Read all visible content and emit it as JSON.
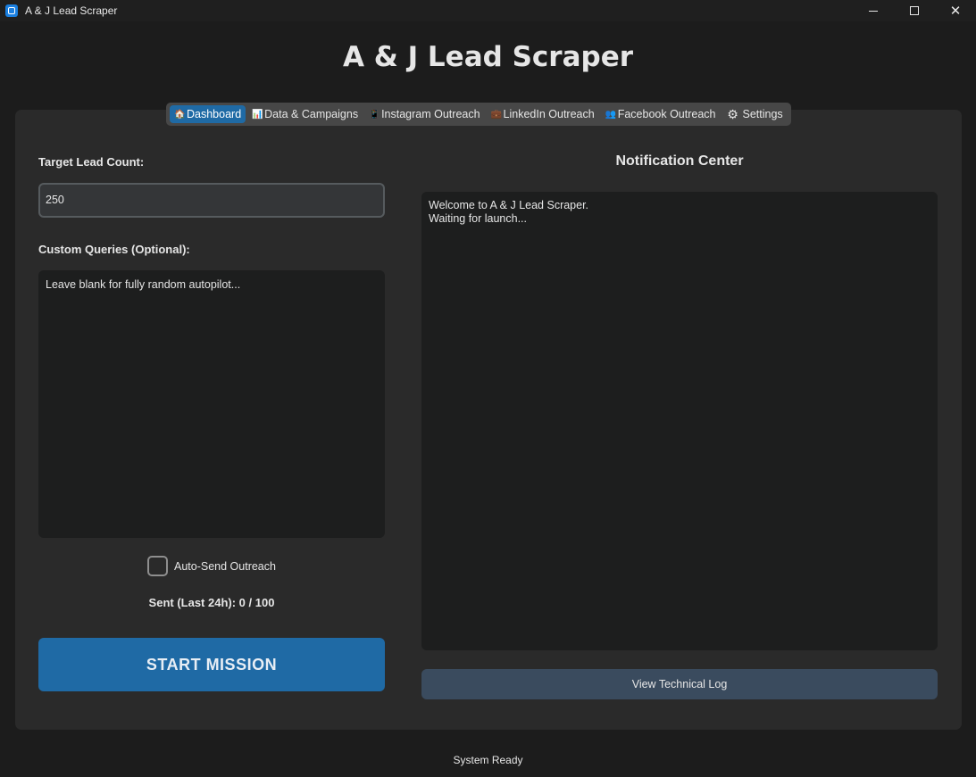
{
  "window": {
    "title": "A & J Lead Scraper",
    "controls": {
      "minimize": "",
      "maximize": "",
      "close": "✕"
    }
  },
  "header": {
    "title": "A & J Lead Scraper"
  },
  "tabs": [
    {
      "label": "Dashboard",
      "icon": "home-icon",
      "glyph": "🏠",
      "active": true
    },
    {
      "label": "Data & Campaigns",
      "icon": "chart-icon",
      "glyph": "📊",
      "active": false
    },
    {
      "label": "Instagram Outreach",
      "icon": "phone-icon",
      "glyph": "📱",
      "active": false
    },
    {
      "label": "LinkedIn Outreach",
      "icon": "briefcase-icon",
      "glyph": "💼",
      "active": false
    },
    {
      "label": "Facebook Outreach",
      "icon": "people-icon",
      "glyph": "👥",
      "active": false
    },
    {
      "label": "Settings",
      "icon": "gear-icon",
      "glyph": "⚙",
      "active": false
    }
  ],
  "form": {
    "target_label": "Target Lead Count:",
    "target_value": "250",
    "queries_label": "Custom Queries (Optional):",
    "queries_placeholder": "Leave blank for fully random autopilot...",
    "auto_send_label": "Auto-Send Outreach",
    "auto_send_checked": false,
    "sent_text": "Sent (Last 24h): 0 / 100",
    "start_button": "START MISSION"
  },
  "notifications": {
    "title": "Notification Center",
    "lines": [
      "Welcome to A & J Lead Scraper.",
      "Waiting for launch..."
    ],
    "log_button": "View Technical Log"
  },
  "status": {
    "text": "System Ready"
  },
  "colors": {
    "accent": "#1f6aa5",
    "background": "#1c1c1c",
    "panel": "#2a2a2a",
    "log_button": "#3a4b5e"
  }
}
